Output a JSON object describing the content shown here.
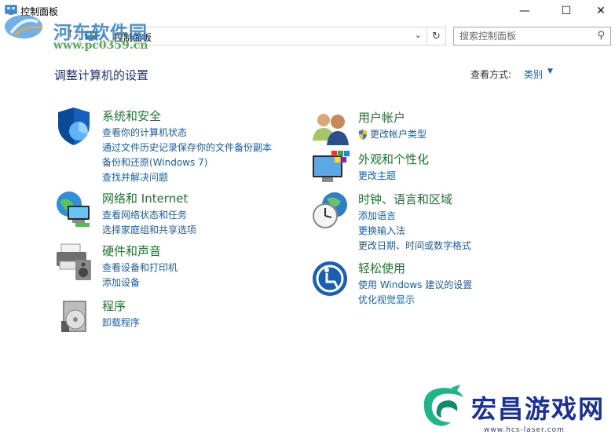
{
  "window": {
    "title": "控制面板",
    "controls": {
      "minimize": "—",
      "maximize": "☐",
      "close": "✕"
    }
  },
  "nav": {
    "back": "←",
    "forward": "→",
    "recent": "⌄",
    "up": "↑",
    "address_separator": "›",
    "address": "控制面板",
    "address_dropdown": "⌄",
    "refresh": "↻",
    "search_placeholder": "搜索控制面板"
  },
  "watermark_top": {
    "name": "河东软件园",
    "url": "www.pc0359.cn"
  },
  "header": {
    "title": "调整计算机的设置",
    "view_by_label": "查看方式:",
    "view_by_value": "类别",
    "view_by_caret": "▼"
  },
  "categories": {
    "system": {
      "title": "系统和安全",
      "icon": "shield-icon",
      "links": [
        "查看你的计算机状态",
        "通过文件历史记录保存你的文件备份副本",
        "备份和还原(Windows 7)",
        "查找并解决问题"
      ]
    },
    "network": {
      "title": "网络和 Internet",
      "icon": "network-globe-icon",
      "links": [
        "查看网络状态和任务",
        "选择家庭组和共享选项"
      ]
    },
    "hardware": {
      "title": "硬件和声音",
      "icon": "printer-speaker-icon",
      "links": [
        "查看设备和打印机",
        "添加设备"
      ]
    },
    "programs": {
      "title": "程序",
      "icon": "programs-disc-icon",
      "links": [
        "卸载程序"
      ]
    },
    "users": {
      "title": "用户帐户",
      "icon": "users-icon",
      "links": [
        "更改帐户类型"
      ]
    },
    "appearance": {
      "title": "外观和个性化",
      "icon": "monitor-palette-icon",
      "links": [
        "更改主题"
      ]
    },
    "clock": {
      "title": "时钟、语言和区域",
      "icon": "clock-globe-icon",
      "links": [
        "添加语言",
        "更换输入法",
        "更改日期、时间或数字格式"
      ]
    },
    "ease": {
      "title": "轻松使用",
      "icon": "ease-of-access-icon",
      "links": [
        "使用 Windows 建议的设置",
        "优化视觉显示"
      ]
    }
  },
  "watermark_bottom": {
    "brand": "宏昌游戏网",
    "url": "www.hcs-laser.com"
  },
  "colors": {
    "category_title": "#1b7a2f",
    "link": "#1a5fb4",
    "page_title": "#1e3287",
    "brand_blue": "#1a2f99"
  }
}
